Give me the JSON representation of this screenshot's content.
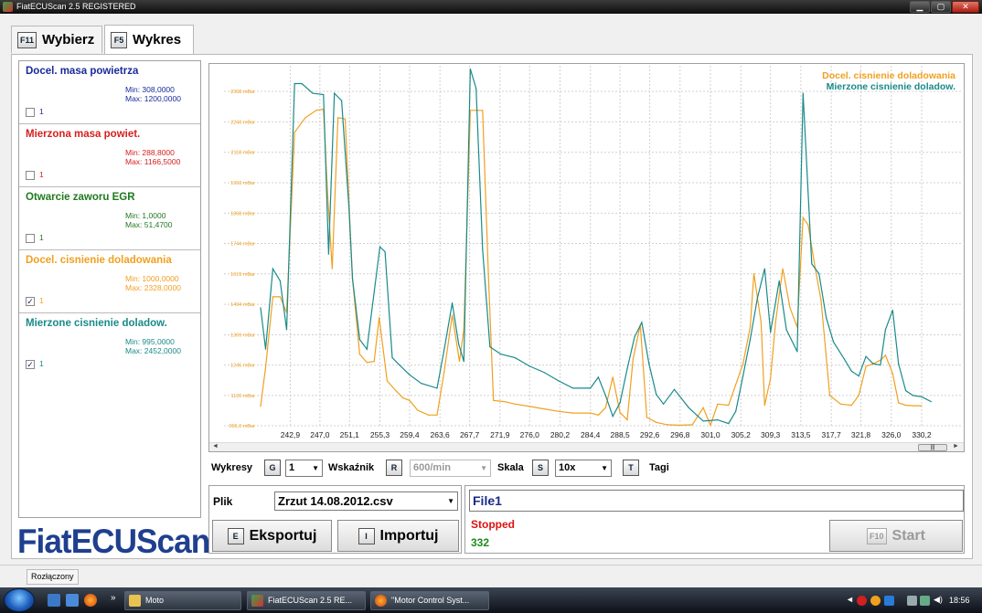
{
  "window": {
    "title": "FiatECUScan 2.5 REGISTERED",
    "min_icon": "minimize-icon",
    "max_icon": "maximize-icon",
    "close_icon": "close-icon"
  },
  "tabs": [
    {
      "key": "F11",
      "label": "Wybierz",
      "active": false
    },
    {
      "key": "F5",
      "label": "Wykres",
      "active": true
    }
  ],
  "sensors": [
    {
      "name": "Docel. masa powietrza",
      "min": "Min: 308,0000",
      "max": "Max: 1200,0000",
      "checked": false,
      "value": "1",
      "color": "#1a2a9a"
    },
    {
      "name": "Mierzona masa powiet.",
      "min": "Min: 288,8000",
      "max": "Max: 1166,5000",
      "checked": false,
      "value": "1",
      "color": "#d42020"
    },
    {
      "name": "Otwarcie zaworu EGR",
      "min": "Min: 1,0000",
      "max": "Max: 51,4700",
      "checked": false,
      "value": "1",
      "color": "#1f7a1f"
    },
    {
      "name": "Docel. cisnienie doladowania",
      "min": "Min: 1000,0000",
      "max": "Max: 2328,0000",
      "checked": true,
      "value": "1",
      "color": "#f0a020"
    },
    {
      "name": "Mierzone cisnienie doladow.",
      "min": "Min: 995,0000",
      "max": "Max: 2452,0000",
      "checked": true,
      "value": "1",
      "color": "#1a8a8a"
    }
  ],
  "logo": "FiatECUScan",
  "chart_data": {
    "type": "line",
    "legend_position": "top-right",
    "grid": true,
    "y_ticks": [
      "996,0 mBar",
      "1120 mBar",
      "1245 mBar",
      "1369 mBar",
      "1494 mBar",
      "1619 mBar",
      "1744 mBar",
      "1868 mBar",
      "1993 mBar",
      "2118 mBar",
      "2243 mBar",
      "2368 mBar"
    ],
    "y_tick_values": [
      996,
      1120,
      1245,
      1369,
      1494,
      1619,
      1744,
      1868,
      1993,
      2118,
      2243,
      2368
    ],
    "ylim": [
      996,
      2368
    ],
    "x_ticks": [
      "242,9",
      "247,0",
      "251,1",
      "255,3",
      "259,4",
      "263,6",
      "267,7",
      "271,9",
      "276,0",
      "280,2",
      "284,4",
      "288,5",
      "292,6",
      "296,8",
      "301,0",
      "305,2",
      "309,3",
      "313,5",
      "317,7",
      "321,8",
      "326,0",
      "330,2"
    ],
    "x_tick_values": [
      242.9,
      247.0,
      251.1,
      255.3,
      259.4,
      263.6,
      267.7,
      271.9,
      276.0,
      280.2,
      284.4,
      288.5,
      292.6,
      296.8,
      301.0,
      305.2,
      309.3,
      313.5,
      317.7,
      321.8,
      326.0,
      330.2
    ],
    "xlim": [
      238.8,
      334.5
    ],
    "series": [
      {
        "name": "Docel. cisnienie doladowania",
        "color": "#f0a020",
        "points": [
          [
            238.8,
            1075
          ],
          [
            239.5,
            1235
          ],
          [
            240.5,
            1525
          ],
          [
            241.5,
            1525
          ],
          [
            242.4,
            1460
          ],
          [
            243.5,
            2200
          ],
          [
            245,
            2260
          ],
          [
            246.5,
            2290
          ],
          [
            247.5,
            2295
          ],
          [
            248,
            1980
          ],
          [
            248.7,
            1640
          ],
          [
            249.5,
            2260
          ],
          [
            250.5,
            2255
          ],
          [
            251.5,
            1600
          ],
          [
            252.5,
            1290
          ],
          [
            253.5,
            1255
          ],
          [
            254.5,
            1260
          ],
          [
            255.2,
            1440
          ],
          [
            256.3,
            1180
          ],
          [
            257.5,
            1140
          ],
          [
            258.5,
            1110
          ],
          [
            259.4,
            1100
          ],
          [
            260.5,
            1060
          ],
          [
            262,
            1040
          ],
          [
            263.2,
            1040
          ],
          [
            264.2,
            1220
          ],
          [
            265.3,
            1450
          ],
          [
            266.3,
            1260
          ],
          [
            266.9,
            1390
          ],
          [
            267.8,
            2290
          ],
          [
            268.6,
            2290
          ],
          [
            269.5,
            2290
          ],
          [
            270.3,
            1610
          ],
          [
            271,
            1100
          ],
          [
            272.5,
            1095
          ],
          [
            274,
            1085
          ],
          [
            276,
            1075
          ],
          [
            278,
            1065
          ],
          [
            280,
            1055
          ],
          [
            282,
            1048
          ],
          [
            284.4,
            1048
          ],
          [
            285.5,
            1040
          ],
          [
            286.5,
            1070
          ],
          [
            287.5,
            1195
          ],
          [
            288.5,
            1050
          ],
          [
            289.5,
            1020
          ],
          [
            290.3,
            1270
          ],
          [
            291.3,
            1410
          ],
          [
            292.2,
            1030
          ],
          [
            293.5,
            1010
          ],
          [
            295,
            1000
          ],
          [
            296.8,
            998
          ],
          [
            298.5,
            1000
          ],
          [
            300,
            1070
          ],
          [
            301,
            998
          ],
          [
            302,
            1085
          ],
          [
            303.5,
            1080
          ],
          [
            304.5,
            1165
          ],
          [
            305.5,
            1250
          ],
          [
            306.5,
            1400
          ],
          [
            307,
            1620
          ],
          [
            308,
            1420
          ],
          [
            308.5,
            1080
          ],
          [
            309.3,
            1190
          ],
          [
            310,
            1420
          ],
          [
            311,
            1640
          ],
          [
            312,
            1480
          ],
          [
            313,
            1400
          ],
          [
            313.8,
            1850
          ],
          [
            314.5,
            1820
          ],
          [
            315.5,
            1640
          ],
          [
            316.3,
            1510
          ],
          [
            317.5,
            1120
          ],
          [
            319,
            1085
          ],
          [
            320.5,
            1080
          ],
          [
            321.5,
            1120
          ],
          [
            322.5,
            1240
          ],
          [
            323.5,
            1250
          ],
          [
            324.5,
            1265
          ],
          [
            325.2,
            1285
          ],
          [
            326.2,
            1210
          ],
          [
            327,
            1090
          ],
          [
            328,
            1080
          ],
          [
            329,
            1078
          ],
          [
            330.2,
            1078
          ]
        ]
      },
      {
        "name": "Mierzone cisnienie doladow.",
        "color": "#1a8a8a",
        "points": [
          [
            238.8,
            1480
          ],
          [
            239.5,
            1310
          ],
          [
            240.5,
            1640
          ],
          [
            241.5,
            1590
          ],
          [
            242.4,
            1390
          ],
          [
            243.5,
            2400
          ],
          [
            244.5,
            2400
          ],
          [
            246,
            2360
          ],
          [
            247.5,
            2355
          ],
          [
            248.2,
            1700
          ],
          [
            249,
            2360
          ],
          [
            250,
            2330
          ],
          [
            251,
            1900
          ],
          [
            251.5,
            1600
          ],
          [
            252.5,
            1350
          ],
          [
            253.5,
            1310
          ],
          [
            255.3,
            1730
          ],
          [
            256,
            1710
          ],
          [
            257,
            1275
          ],
          [
            258,
            1245
          ],
          [
            259.4,
            1205
          ],
          [
            261,
            1170
          ],
          [
            263.2,
            1150
          ],
          [
            264.2,
            1310
          ],
          [
            265.3,
            1500
          ],
          [
            266.2,
            1330
          ],
          [
            266.9,
            1260
          ],
          [
            267.8,
            2460
          ],
          [
            268.6,
            2380
          ],
          [
            269.5,
            1720
          ],
          [
            270.5,
            1320
          ],
          [
            272,
            1290
          ],
          [
            274,
            1275
          ],
          [
            276,
            1240
          ],
          [
            278,
            1215
          ],
          [
            280,
            1180
          ],
          [
            282,
            1150
          ],
          [
            284.4,
            1150
          ],
          [
            285.5,
            1195
          ],
          [
            286.5,
            1120
          ],
          [
            287.5,
            1035
          ],
          [
            288.5,
            1090
          ],
          [
            289.5,
            1230
          ],
          [
            290.5,
            1360
          ],
          [
            291.5,
            1420
          ],
          [
            292.5,
            1250
          ],
          [
            293.5,
            1125
          ],
          [
            294.5,
            1085
          ],
          [
            296,
            1145
          ],
          [
            298,
            1070
          ],
          [
            300,
            1015
          ],
          [
            302,
            1020
          ],
          [
            303.5,
            1005
          ],
          [
            304.5,
            1055
          ],
          [
            305.5,
            1200
          ],
          [
            306.5,
            1350
          ],
          [
            307.5,
            1520
          ],
          [
            308.5,
            1640
          ],
          [
            309.3,
            1380
          ],
          [
            310.5,
            1590
          ],
          [
            311.5,
            1390
          ],
          [
            313,
            1300
          ],
          [
            313.8,
            2360
          ],
          [
            315,
            1660
          ],
          [
            316,
            1620
          ],
          [
            317,
            1440
          ],
          [
            318,
            1340
          ],
          [
            319.5,
            1270
          ],
          [
            320.5,
            1220
          ],
          [
            321.5,
            1200
          ],
          [
            322.5,
            1280
          ],
          [
            323.5,
            1250
          ],
          [
            324.5,
            1245
          ],
          [
            325.2,
            1390
          ],
          [
            326.2,
            1470
          ],
          [
            327,
            1250
          ],
          [
            328,
            1140
          ],
          [
            329,
            1120
          ],
          [
            330.2,
            1115
          ],
          [
            331.5,
            1095
          ]
        ]
      }
    ]
  },
  "toolbar": {
    "wykresy_label": "Wykresy",
    "wykresy_key": "G",
    "wykresy_value": "1",
    "wskaznik_label": "Wskaźnik",
    "wskaznik_key": "R",
    "wskaznik_value": "600/min",
    "skala_label": "Skala",
    "skala_key": "S",
    "skala_value": "10x",
    "tagi_key": "T",
    "tagi_label": "Tagi"
  },
  "file": {
    "label": "Plik",
    "selected": "Zrzut 14.08.2012.csv",
    "export_key": "E",
    "export_label": "Eksportuj",
    "import_key": "I",
    "import_label": "Importuj"
  },
  "status": {
    "file_name": "File1",
    "state": "Stopped",
    "count": "332",
    "start_key": "F10",
    "start_label": "Start"
  },
  "statusbar": {
    "connection": "Rozłączony"
  },
  "taskbar": {
    "items": [
      {
        "label": "Moto",
        "icon": "folder-icon"
      },
      {
        "label": "FiatECUScan 2.5 RE...",
        "icon": "fiatecuscan-icon"
      },
      {
        "label": "\"Motor Control Syst...",
        "icon": "firefox-icon"
      }
    ],
    "clock": "18:56"
  }
}
